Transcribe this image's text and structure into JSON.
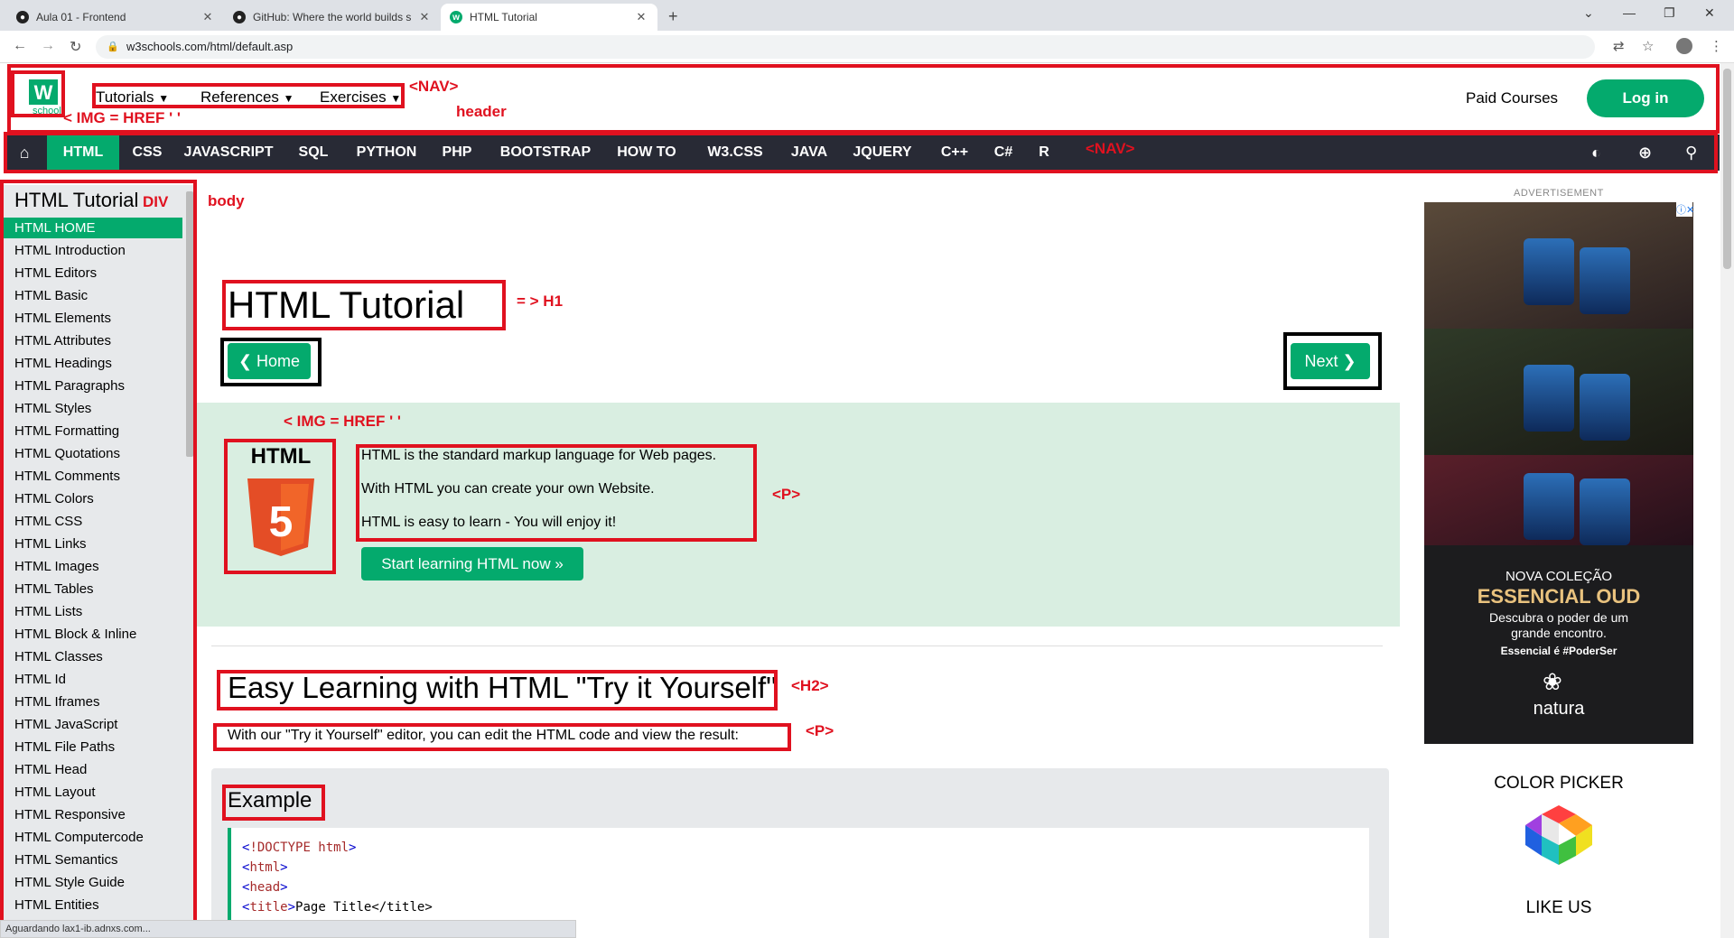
{
  "browser": {
    "tabs": [
      {
        "title": "Aula 01 - Frontend",
        "favicon": "github-icon"
      },
      {
        "title": "GitHub: Where the world builds s",
        "favicon": "github-icon"
      },
      {
        "title": "HTML Tutorial",
        "favicon": "w3schools-icon"
      }
    ],
    "url": "w3schools.com/html/default.asp"
  },
  "header": {
    "logo_text": "school",
    "menu": [
      "Tutorials",
      "References",
      "Exercises"
    ],
    "paid_courses": "Paid Courses",
    "login": "Log in"
  },
  "topnav": {
    "items": [
      "HTML",
      "CSS",
      "JAVASCRIPT",
      "SQL",
      "PYTHON",
      "PHP",
      "BOOTSTRAP",
      "HOW TO",
      "W3.CSS",
      "JAVA",
      "JQUERY",
      "C++",
      "C#",
      "R"
    ],
    "active": "HTML"
  },
  "sidebar": {
    "title": "HTML Tutorial",
    "items": [
      "HTML HOME",
      "HTML Introduction",
      "HTML Editors",
      "HTML Basic",
      "HTML Elements",
      "HTML Attributes",
      "HTML Headings",
      "HTML Paragraphs",
      "HTML Styles",
      "HTML Formatting",
      "HTML Quotations",
      "HTML Comments",
      "HTML Colors",
      "HTML CSS",
      "HTML Links",
      "HTML Images",
      "HTML Tables",
      "HTML Lists",
      "HTML Block & Inline",
      "HTML Classes",
      "HTML Id",
      "HTML Iframes",
      "HTML JavaScript",
      "HTML File Paths",
      "HTML Head",
      "HTML Layout",
      "HTML Responsive",
      "HTML Computercode",
      "HTML Semantics",
      "HTML Style Guide",
      "HTML Entities"
    ],
    "active": "HTML HOME"
  },
  "main": {
    "h1": "HTML Tutorial",
    "home_button": "❮ Home",
    "next_button": "Next ❯",
    "html5_label": "HTML",
    "hero_paragraphs": [
      "HTML is the standard markup language for Web pages.",
      "With HTML you can create your own Website.",
      "HTML is easy to learn - You will enjoy it!"
    ],
    "start_button": "Start learning HTML now »",
    "h2": "Easy Learning with HTML \"Try it Yourself\"",
    "p2": "With our \"Try it Yourself\" editor, you can edit the HTML code and view the result:",
    "example_title": "Example",
    "code": [
      {
        "open": "<",
        "tag": "!DOCTYPE",
        "attr": " html",
        "close": ">",
        "text": ""
      },
      {
        "open": "<",
        "tag": "html",
        "attr": "",
        "close": ">",
        "text": ""
      },
      {
        "open": "<",
        "tag": "head",
        "attr": "",
        "close": ">",
        "text": ""
      },
      {
        "open": "<",
        "tag": "title",
        "attr": "",
        "close": ">",
        "text": "Page Title</title>"
      }
    ]
  },
  "right": {
    "advertisement": "ADVERTISEMENT",
    "ad_text": [
      "NOVA COLEÇÃO",
      "ESSENCIAL OUD",
      "Descubra o poder de um grande encontro.",
      "Essencial é #PoderSer",
      "natura"
    ],
    "color_picker": "COLOR PICKER",
    "like_us": "LIKE US"
  },
  "annotations": {
    "nav_top": "<NAV>",
    "header": "header",
    "img_logo": "< IMG = HREF '   '",
    "nav_dark": "<NAV>",
    "div": "DIV",
    "body": "body",
    "h1": "= > H1",
    "img_html5": "< IMG = HREF '  '",
    "p_hero": "<P>",
    "h2": "<H2>",
    "p2": "<P>"
  },
  "status": "Aguardando lax1-ib.adnxs.com..."
}
